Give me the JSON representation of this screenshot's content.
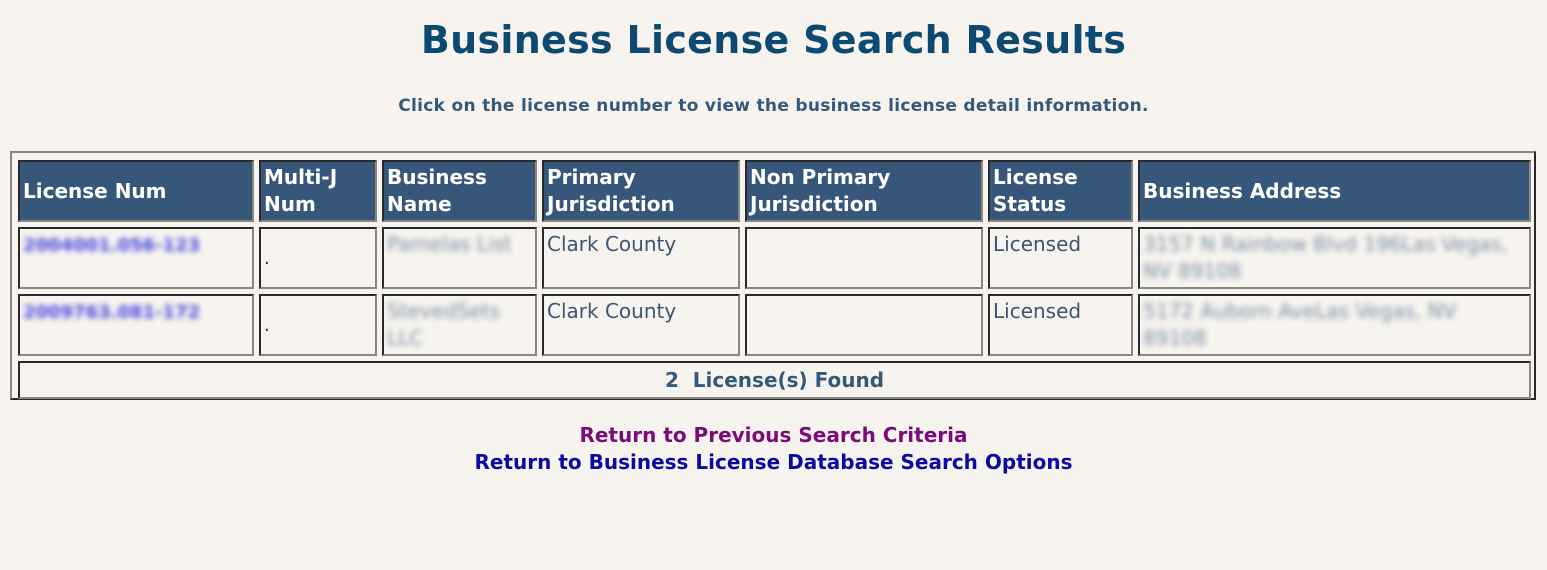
{
  "page": {
    "title": "Business License Search Results",
    "subtitle": "Click on the license number to view the business license detail information."
  },
  "table": {
    "headers": [
      "License Num",
      "Multi-J Num",
      "Business Name",
      "Primary Jurisdiction",
      "Non Primary Jurisdiction",
      "License Status",
      "Business Address"
    ],
    "rows": [
      {
        "license_num": "2004001.056-123",
        "multi_j_num": ".",
        "business_name": "Pamelas List",
        "primary_jurisdiction": "Clark County",
        "non_primary_jurisdiction": "",
        "license_status": "Licensed",
        "business_address": "3157 N Rainbow Blvd 196Las Vegas, NV 89108"
      },
      {
        "license_num": "2009763.081-172",
        "multi_j_num": ".",
        "business_name": "StevedSets LLC",
        "primary_jurisdiction": "Clark County",
        "non_primary_jurisdiction": "",
        "license_status": "Licensed",
        "business_address": "5172 Auborn AveLas Vegas, NV 89108"
      }
    ],
    "count_text": "2  License(s) Found"
  },
  "links": {
    "previous_search": "Return to Previous Search Criteria",
    "search_options": "Return to Business License Database Search Options"
  },
  "colors": {
    "title": "#0d4a72",
    "header_bg": "#36577a",
    "background": "#f7f4ef",
    "visited_link": "#7a0b7a",
    "link": "#0a0aa3"
  }
}
